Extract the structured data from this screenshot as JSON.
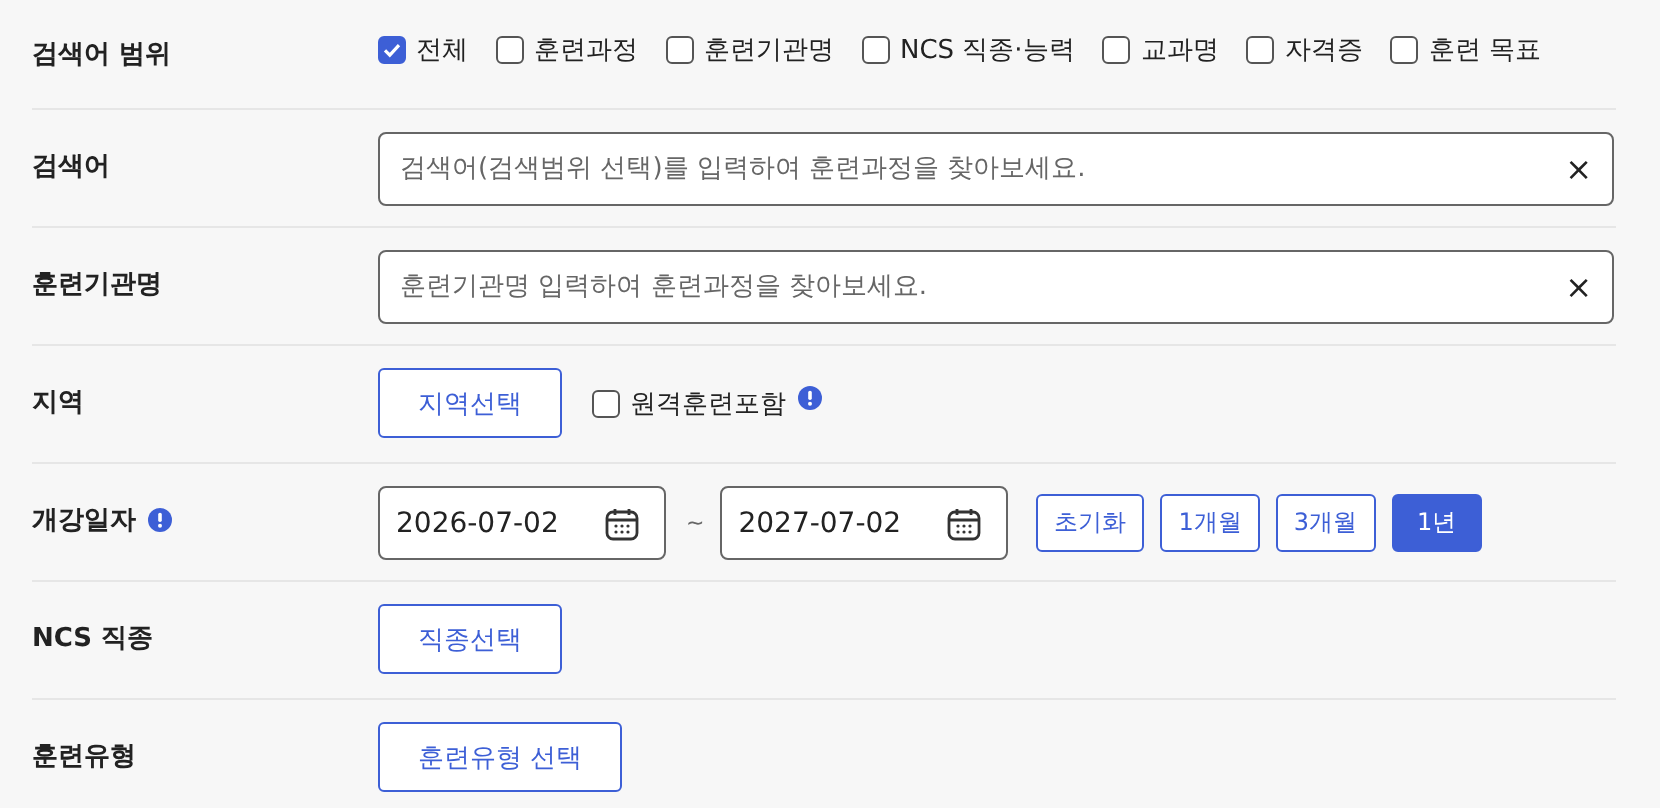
{
  "rows": [
    {
      "kind": "checks",
      "label": "검색어 범위",
      "options": [
        {
          "label": "전체",
          "checked": true
        },
        {
          "label": "훈련과정",
          "checked": false
        },
        {
          "label": "훈련기관명",
          "checked": false
        },
        {
          "label": "NCS 직종·능력",
          "checked": false
        },
        {
          "label": "교과명",
          "checked": false
        },
        {
          "label": "자격증",
          "checked": false
        },
        {
          "label": "훈련 목표",
          "checked": false
        }
      ]
    },
    {
      "kind": "search",
      "label": "검색어",
      "placeholder": "검색어(검색범위 선택)를 입력하여 훈련과정을 찾아보세요.",
      "clear": "×"
    },
    {
      "kind": "search",
      "label": "훈련기관명",
      "placeholder": "훈련기관명 입력하여 훈련과정을 찾아보세요.",
      "clear": "×"
    },
    {
      "kind": "region",
      "label": "지역",
      "button": "지역선택",
      "option": {
        "label": "원격훈련포함",
        "checked": false
      }
    },
    {
      "kind": "date",
      "label": "개강일자",
      "start": "2026-07-02",
      "separator": "~",
      "end": "2027-07-02",
      "periods": [
        {
          "label": "초기화",
          "selected": false
        },
        {
          "label": "1개월",
          "selected": false
        },
        {
          "label": "3개월",
          "selected": false
        },
        {
          "label": "1년",
          "selected": true
        }
      ]
    },
    {
      "kind": "button",
      "label": "NCS 직종",
      "button": "직종선택"
    },
    {
      "kind": "button",
      "label": "훈련유형",
      "button": "훈련유형 선택"
    }
  ]
}
